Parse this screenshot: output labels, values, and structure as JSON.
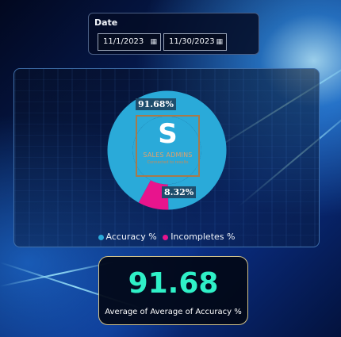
{
  "date_slicer": {
    "title": "Date",
    "start_date": "11/1/2023",
    "end_date": "11/30/2023",
    "calendar_icon": "calendar-icon"
  },
  "chart_data": {
    "type": "pie",
    "donut": true,
    "categories": [
      "Accuracy %",
      "Incompletes %"
    ],
    "values": [
      91.68,
      8.32
    ],
    "data_labels": [
      "91.68%",
      "8.32%"
    ],
    "colors": [
      "#2aaad9",
      "#e8148d"
    ],
    "legend_position": "bottom"
  },
  "logo": {
    "letter": "S",
    "name": "SALES ADMINS",
    "tagline": "Connected to results"
  },
  "kpi_card": {
    "value": "91.68",
    "caption": "Average of Average of Accuracy %",
    "color": "#2ff0c7"
  }
}
